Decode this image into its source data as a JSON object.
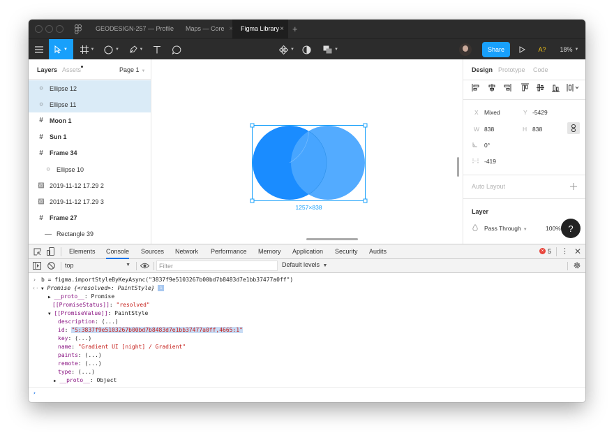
{
  "tabs": [
    {
      "label": "GEODESIGN-257 — Profile",
      "close": "×"
    },
    {
      "label": "Maps — Core",
      "close": "×"
    },
    {
      "label": "Figma Library",
      "close": "×"
    }
  ],
  "new_tab_symbol": "+",
  "toolbar": {
    "share_label": "Share",
    "font_missing_label": "A?",
    "zoom_label": "18%"
  },
  "layers_panel": {
    "tab_layers": "Layers",
    "tab_assets": "Assets",
    "page_label": "Page 1",
    "items": [
      {
        "label": "Ellipse 12",
        "icon": "ellipse-icon"
      },
      {
        "label": "Ellipse 11",
        "icon": "ellipse-icon"
      },
      {
        "label": "Moon 1",
        "icon": "frame-icon"
      },
      {
        "label": "Sun 1",
        "icon": "frame-icon"
      },
      {
        "label": "Frame 34",
        "icon": "frame-icon"
      },
      {
        "label": "Ellipse 10",
        "icon": "ellipse-icon"
      },
      {
        "label": "2019-11-12 17.29 2",
        "icon": "image-icon"
      },
      {
        "label": "2019-11-12 17.29 3",
        "icon": "image-icon"
      },
      {
        "label": "Frame 27",
        "icon": "frame-icon"
      },
      {
        "label": "Rectangle 39",
        "icon": "rectangle-icon"
      }
    ]
  },
  "canvas": {
    "size_label": "1257×838",
    "ellipse_color": "#1a8cff",
    "ellipse2_color": "#4aa6ff"
  },
  "design_panel": {
    "tab_design": "Design",
    "tab_prototype": "Prototype",
    "tab_code": "Code",
    "x_label": "X",
    "x_value": "Mixed",
    "y_label": "Y",
    "y_value": "-5429",
    "w_label": "W",
    "w_value": "838",
    "h_label": "H",
    "h_value": "838",
    "rotation_value": "0°",
    "radius_value": "-419",
    "auto_layout_label": "Auto Layout",
    "layer_label": "Layer",
    "blend_label": "Pass Through",
    "opacity_value": "100%",
    "help_label": "?"
  },
  "devtools": {
    "tabs": [
      "Elements",
      "Console",
      "Sources",
      "Network",
      "Performance",
      "Memory",
      "Application",
      "Security",
      "Audits"
    ],
    "error_count": "5",
    "context": "top",
    "filter_placeholder": "Filter",
    "levels": "Default levels"
  },
  "console": {
    "input_line": "b = figma.importStyleByKeyAsync(\"3837f9e5103267b00bd7b8483d7e1bb37477a0ff\")",
    "promise_line": "Promise {<resolved>: PaintStyle}",
    "proto_label": "__proto__",
    "proto_value": "Promise",
    "status_key": "[[PromiseStatus]]",
    "status_value": "\"resolved\"",
    "value_key": "[[PromiseValue]]",
    "value_value": "PaintStyle",
    "fields": [
      {
        "key": "description",
        "value": "(...)"
      },
      {
        "key": "id",
        "value": "\"S:3837f9e5103267b00bd7b8483d7e1bb37477a0ff,4665:1\""
      },
      {
        "key": "key",
        "value": "(...)"
      },
      {
        "key": "name",
        "value": "\"Gradient UI [night] / Gradient\""
      },
      {
        "key": "paints",
        "value": "(...)"
      },
      {
        "key": "remote",
        "value": "(...)"
      },
      {
        "key": "type",
        "value": "(...)"
      }
    ],
    "proto2_value": "Object"
  }
}
